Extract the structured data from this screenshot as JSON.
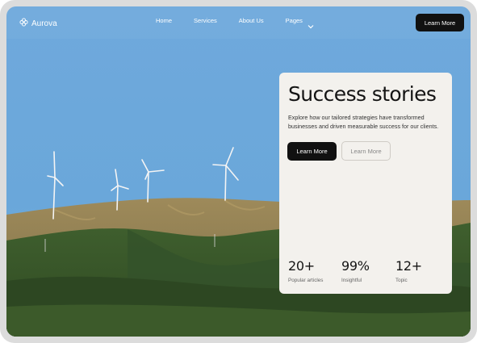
{
  "nav": {
    "brand": "Aurova",
    "links": [
      "Home",
      "Services",
      "About Us",
      "Pages"
    ],
    "cta": "Learn More"
  },
  "hero": {
    "title": "Success stories",
    "description": "Explore how our tailored strategies have transformed businesses and driven measurable success for our clients.",
    "primary_button": "Learn More",
    "secondary_button": "Learn More",
    "stats": [
      {
        "value": "20+",
        "label": "Popular articles"
      },
      {
        "value": "99%",
        "label": "Insightful"
      },
      {
        "value": "12+",
        "label": "Topic"
      }
    ]
  },
  "icons": {
    "brand": "flower-logo-icon",
    "pages_dropdown": "chevron-down-icon"
  },
  "colors": {
    "sky": "#6aa9dc",
    "card": "#f3f1ed",
    "button_dark": "#111111"
  }
}
